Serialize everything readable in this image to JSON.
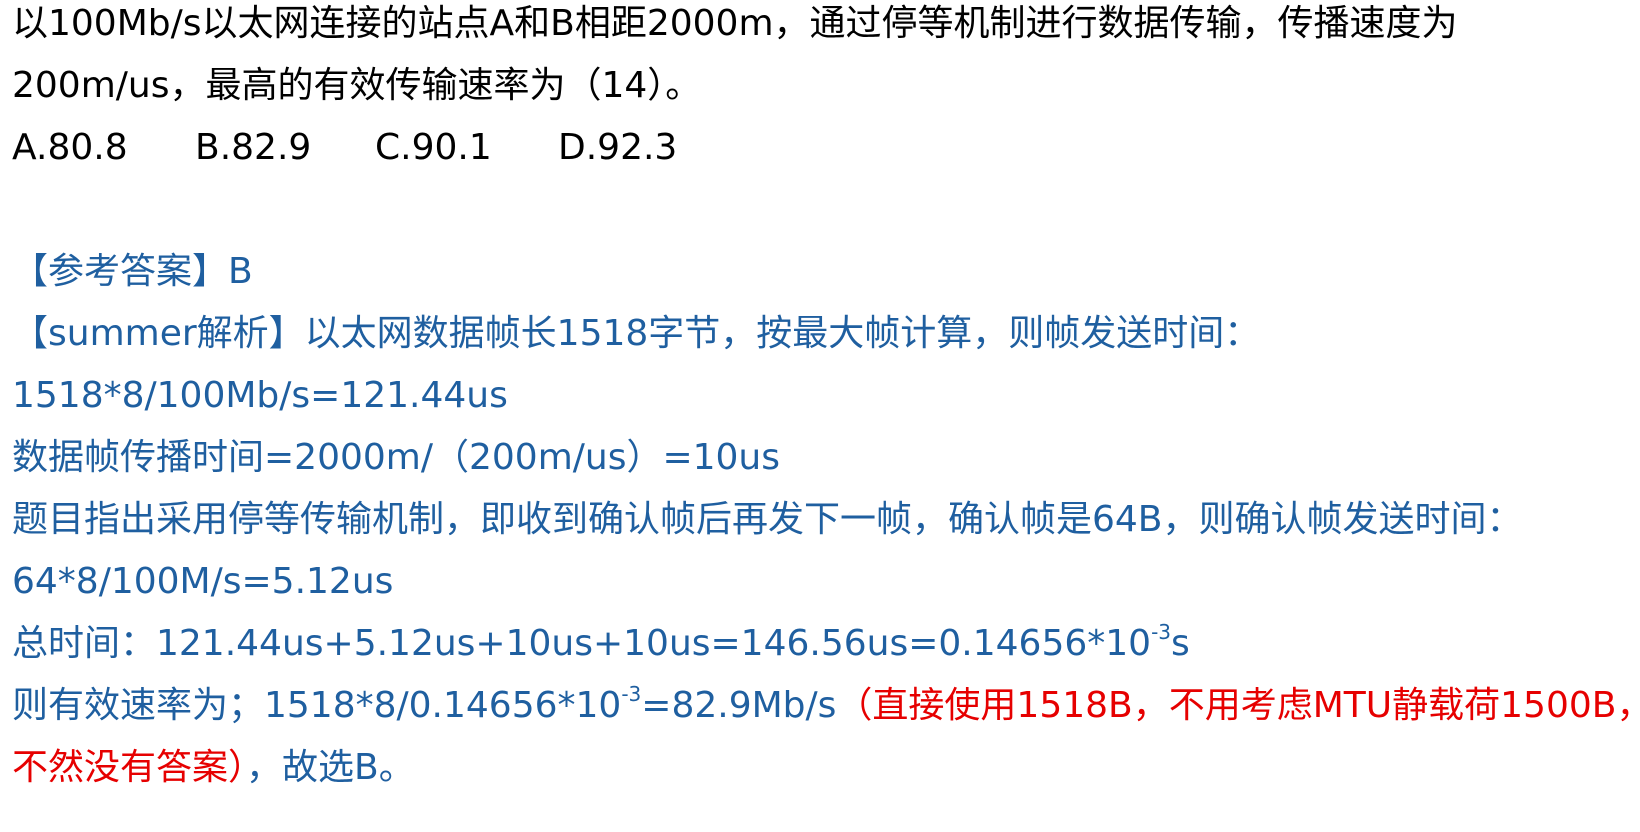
{
  "question": {
    "line1": "以100Mb/s以太网连接的站点A和B相距2000m，通过停等机制进行数据传输，传播速度为",
    "line2": "200m/us，最高的有效传输速率为（14）。",
    "options": [
      "A.80.8",
      "B.82.9",
      "C.90.1",
      "D.92.3"
    ]
  },
  "answer": {
    "reference": "【参考答案】B",
    "analysis_intro": "【summer解析】以太网数据帧长1518字节，按最大帧计算，则帧发送时间：",
    "step1": "1518*8/100Mb/s=121.44us",
    "step2": "数据帧传播时间=2000m/（200m/us）=10us",
    "step3": "题目指出采用停等传输机制，即收到确认帧后再发下一帧，确认帧是64B，则确认帧发送时间：",
    "step4": "64*8/100M/s=5.12us",
    "total_prefix": "总时间：121.44us+5.12us+10us+10us=146.56us=0.14656*10",
    "total_exp": "-3",
    "total_suffix": "s",
    "rate_prefix": "则有效速率为；1518*8/0.14656*10",
    "rate_exp": "-3",
    "rate_suffix": "=82.9Mb/s",
    "note_part1": "（直接使用1518B，不用考虑MTU静载荷1500B，",
    "note_part2": "不然没有答案）",
    "conclusion": "，故选B。"
  },
  "colors": {
    "question": "#000000",
    "analysis": "#1f5fa0",
    "note": "#e60000"
  }
}
